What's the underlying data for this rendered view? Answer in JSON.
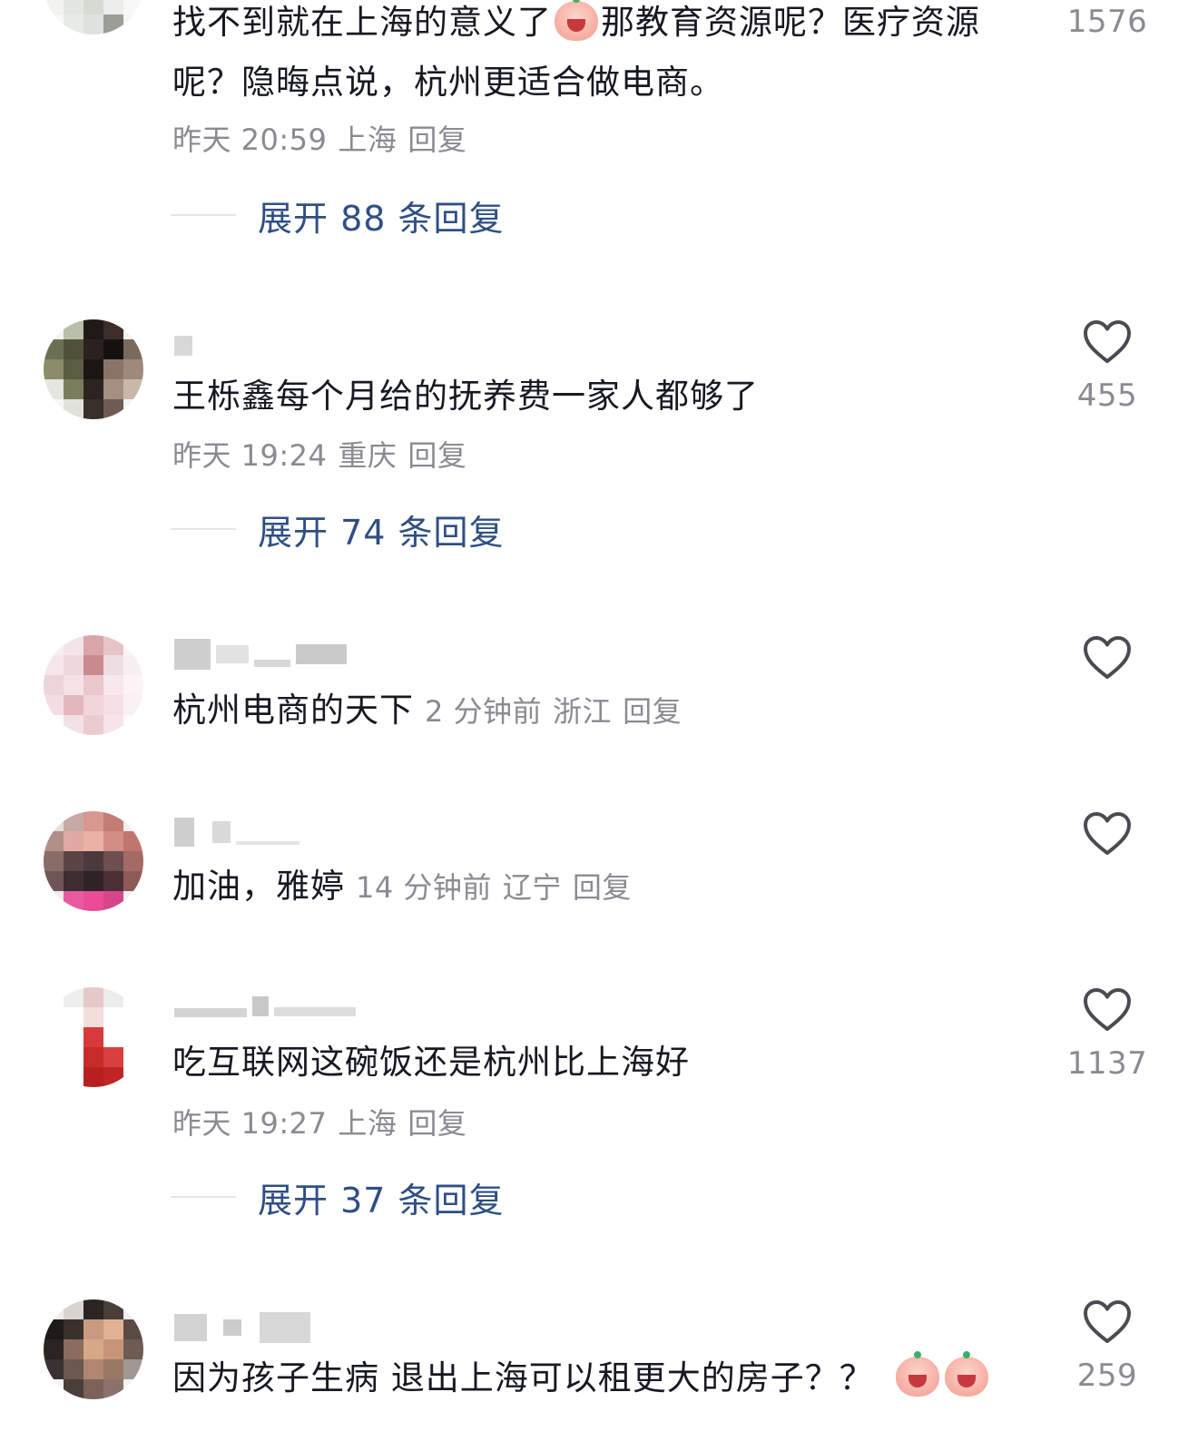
{
  "icons": {
    "like": "heart-outline-icon",
    "emoji": "crying-face-emoji"
  },
  "colors": {
    "text": "#161823",
    "meta": "#8a8b91",
    "expand_link": "#2f4f84"
  },
  "comments": [
    {
      "text_part1": "找不到就在上海的意义了",
      "text_part2": "那教育资源呢？医疗资源呢？隐晦点说，杭州更适合做电商。",
      "time": "昨天 20:59",
      "location": "上海",
      "reply": "回复",
      "likes": "1576",
      "expand": "展开 88 条回复"
    },
    {
      "text": "王栎鑫每个月给的抚养费一家人都够了",
      "time": "昨天 19:24",
      "location": "重庆",
      "reply": "回复",
      "likes": "455",
      "expand": "展开 74 条回复"
    },
    {
      "text": "杭州电商的天下",
      "time": "2 分钟前",
      "location": "浙江",
      "reply": "回复"
    },
    {
      "text": "加油，雅婷",
      "time": "14 分钟前",
      "location": "辽宁",
      "reply": "回复"
    },
    {
      "text": "吃互联网这碗饭还是杭州比上海好",
      "time": "昨天 19:27",
      "location": "上海",
      "reply": "回复",
      "likes": "1137",
      "expand": "展开 37 条回复"
    },
    {
      "text": "因为孩子生病  退出上海可以租更大的房子？？",
      "likes": "259"
    }
  ]
}
